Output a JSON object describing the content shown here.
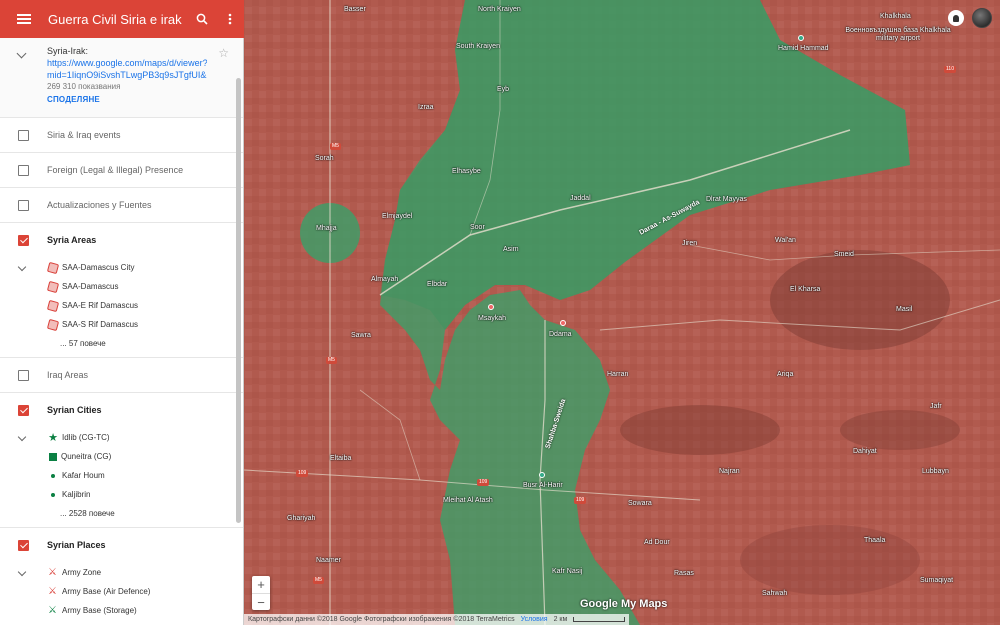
{
  "header": {
    "title": "Guerra Civil Siria e irak"
  },
  "info": {
    "title": "Syria-Irak:",
    "link": "https://www.google.com/maps/d/viewer?mid=1IiqnO9iSvshTLwgPB3q9sJTgfUI&ll=3",
    "views": "269 310 показвания",
    "share": "СПОДЕЛЯНЕ"
  },
  "layers": [
    {
      "name": "Siria & Iraq events",
      "checked": false
    },
    {
      "name": "Foreign (Legal & Illegal) Presence",
      "checked": false
    },
    {
      "name": "Actualizaciones y Fuentes",
      "checked": false
    },
    {
      "name": "Syria Areas",
      "checked": true
    },
    {
      "name": "Iraq Areas",
      "checked": false
    },
    {
      "name": "Syrian Cities",
      "checked": true
    },
    {
      "name": "Syrian Places",
      "checked": true
    }
  ],
  "syria_areas_items": [
    "SAA-Damascus City",
    "SAA-Damascus",
    "SAA-E Rif Damascus",
    "SAA-S Rif Damascus",
    "... 57 повече"
  ],
  "syrian_cities_items": [
    "Idlib (CG-TC)",
    "Quneitra (CG)",
    "Kafar Houm",
    "Kaljibrin",
    "... 2528 повече"
  ],
  "syrian_places_items": [
    "Army Zone",
    "Army Base (Air Defence)",
    "Army Base (Storage)"
  ],
  "map": {
    "labels": {
      "north_kraiyen": "North Kraiyen",
      "south_kraiyen": "South Kraiyen",
      "eyb": "Eyb",
      "hamid": "Hamid Hammad",
      "khalkhala": "Khalkhala",
      "airport": "Военновъздушна база Khalkhala military airport",
      "basser": "Basser",
      "izraa": "Izraa",
      "sorah": "Sorah",
      "elhasybe": "Elhasybe",
      "jaddal": "Jaddal",
      "dlrat_mayyas": "Dlrat Mayyas",
      "mhajja": "Mhajja",
      "elmjaydel": "Elmjaydel",
      "soor": "Soor",
      "asim": "Asim",
      "daraa_sweida": "Daraa - As-Suwayda",
      "jiren": "Jiren",
      "wal_an": "Wal'an",
      "smeid": "Smeid",
      "elkharsa": "El Kharsa",
      "almayah": "Almayah",
      "elbdar": "Elbdar",
      "msayfrah": "Msaykah",
      "ddama": "Ddama",
      "masil": "Masil",
      "sawra": "Sawra",
      "harran": "Harran",
      "ariqa": "Ariqa",
      "jafr": "Jafr",
      "shahba_road": "Shahba-Sweida",
      "busra": "Busr Al-Harir",
      "dahiyat": "Dahiyat",
      "najran": "Najran",
      "lubbayn": "Lubbayn",
      "eltaiba": "Eltaiba",
      "sowara": "Sowara",
      "ghariyah": "Ghariyah",
      "mleihat": "Mleihat Al Atash",
      "ad_dour": "Ad Dour",
      "thaala": "Thaala",
      "kafr_nasij": "Kafr Nasij",
      "naamer": "Naamer",
      "rasas": "Rasas",
      "sahwah": "Sahwah",
      "sumaqiyat": "Sumaqiyat"
    },
    "zoom_in": "+",
    "zoom_out": "−",
    "logo": "Google My Maps",
    "attribution": {
      "data": "Картографски данни ©2018 Google Фотографски изображения ©2018 TerraMetrics",
      "terms": "Условия",
      "scale": "2 км"
    },
    "colors": {
      "red_zone": "#c9554c",
      "green_zone": "#3aa069",
      "header": "#db4437"
    }
  }
}
